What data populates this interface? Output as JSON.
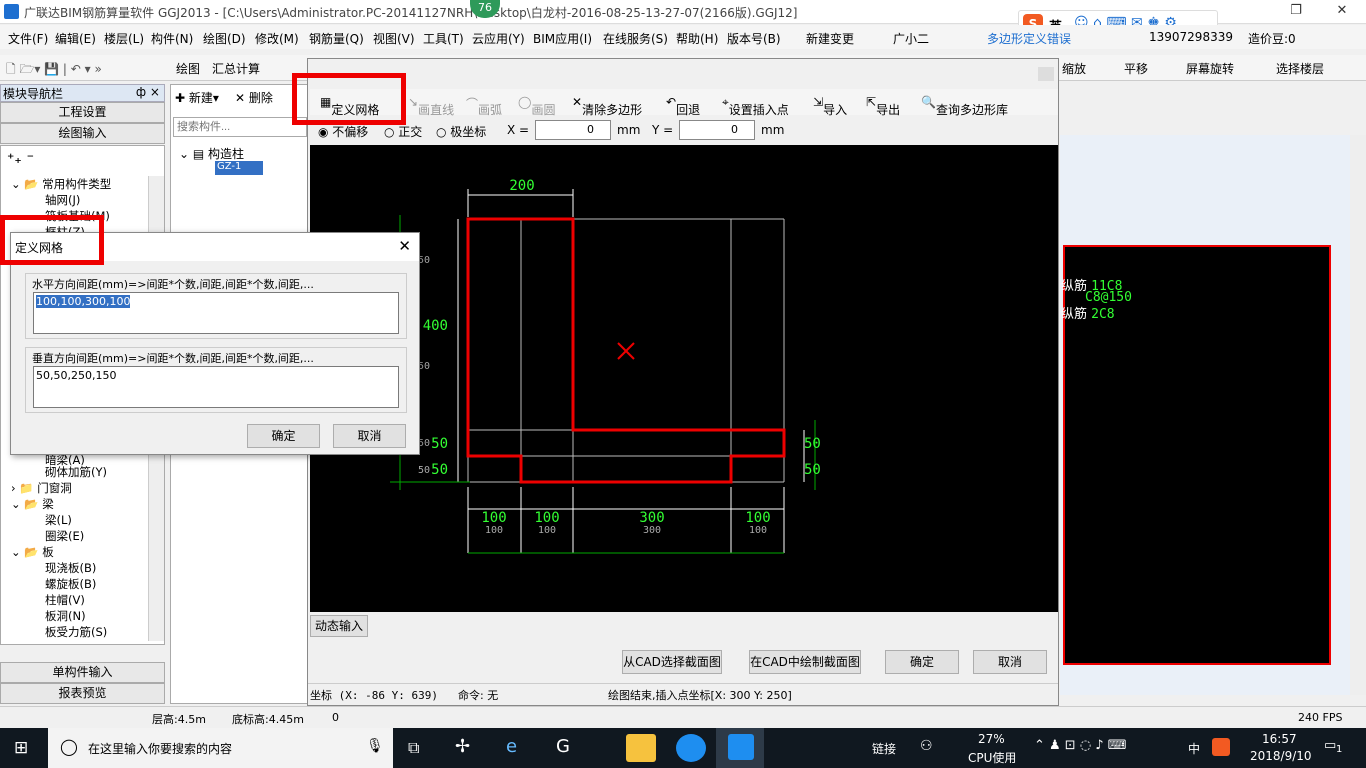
{
  "window": {
    "title": "广联达BIM钢筋算量软件 GGJ2013 - [C:\\Users\\Administrator.PC-20141127NRH\\Desktop\\白龙村-2016-08-25-13-27-07(2166版).GGJ12]",
    "badge": "76"
  },
  "menu": [
    "文件(F)",
    "编辑(E)",
    "楼层(L)",
    "构件(N)",
    "绘图(D)",
    "修改(M)",
    "钢筋量(Q)",
    "视图(V)",
    "工具(T)",
    "云应用(Y)",
    "BIM应用(I)",
    "在线服务(S)",
    "帮助(H)",
    "版本号(B)",
    "新建变更",
    "广小二"
  ],
  "menu_right": {
    "promo": "多边形定义错误",
    "phone": "13907298339",
    "beans": "造价豆:0"
  },
  "toolbar": {
    "draw": "绘图",
    "sum": "汇总计算",
    "zoom": "缩放",
    "pan": "平移",
    "rotate": "屏幕旋转",
    "floor": "选择楼层"
  },
  "ime": {
    "lang": "英"
  },
  "nav": {
    "header": "模块导航栏",
    "pin": "ф ×",
    "project": "工程设置",
    "draw_input": "绘图输入",
    "single": "单构件输入",
    "report": "报表预览"
  },
  "tree": [
    {
      "label": "常用构件类型"
    },
    {
      "label": "轴网(J)"
    },
    {
      "label": "筏板基础(M)"
    },
    {
      "label": "框柱(Z)"
    },
    {
      "label": "暗梁(A)"
    },
    {
      "label": "砌体加筋(Y)"
    },
    {
      "label": "门窗洞"
    },
    {
      "label": "梁"
    },
    {
      "label": "梁(L)"
    },
    {
      "label": "圈梁(E)"
    },
    {
      "label": "板"
    },
    {
      "label": "现浇板(B)"
    },
    {
      "label": "螺旋板(B)"
    },
    {
      "label": "柱帽(V)"
    },
    {
      "label": "板洞(N)"
    },
    {
      "label": "板受力筋(S)"
    }
  ],
  "panel2": {
    "new": "新建",
    "delete": "删除",
    "search_placeholder": "搜索构件...",
    "node": "构造柱",
    "item": "GZ-1"
  },
  "dialog": {
    "toolbar": [
      "定义网格",
      "画直线",
      "画弧",
      "画圆",
      "清除多边形",
      "回退",
      "设置插入点",
      "导入",
      "导出",
      "查询多边形库"
    ],
    "opts": {
      "none": "不偏移",
      "ortho": "正交",
      "polar": "极坐标",
      "x_label": "X =",
      "x_val": "0",
      "y_label": "Y =",
      "y_val": "0",
      "unit": "mm"
    },
    "dyn": "动态输入",
    "buttons": {
      "from_cad": "从CAD选择截面图",
      "in_cad": "在CAD中绘制截面图",
      "ok": "确定",
      "cancel": "取消"
    },
    "status": {
      "coord": "坐标 (X: -86 Y: 639)",
      "cmd": "命令: 无",
      "msg": "绘图结束,插入点坐标[X: 300 Y: 250]"
    }
  },
  "cad": {
    "dims_top": "200",
    "dims_left": [
      "400",
      "50",
      "50"
    ],
    "dims_left_small": [
      "50",
      "50",
      "50",
      "50"
    ],
    "dims_right": [
      "50",
      "50"
    ],
    "dims_bottom": [
      "100",
      "100",
      "300",
      "100"
    ],
    "dims_bottom_small": [
      "100",
      "100",
      "300",
      "100"
    ]
  },
  "rebar": {
    "l1a": "纵筋",
    "l1b": "11C8",
    "l2": "C8@150",
    "l3a": "纵筋",
    "l3b": "2C8"
  },
  "grid_dialog": {
    "title": "定义网格",
    "h_label": "水平方向间距(mm)=>间距*个数,间距,间距*个数,间距,...",
    "h_value": "100,100,300,100",
    "v_label": "垂直方向间距(mm)=>间距*个数,间距,间距*个数,间距,...",
    "v_value": "50,50,250,150",
    "ok": "确定",
    "cancel": "取消"
  },
  "bottom": {
    "floor_h": "层高:4.5m",
    "base_h": "底标高:4.45m",
    "zero": "0",
    "fps": "240 FPS"
  },
  "taskbar": {
    "search": "在这里输入你要搜索的内容",
    "link": "链接",
    "cpu_pct": "27%",
    "cpu": "CPU使用",
    "ime": "中",
    "time": "16:57",
    "date": "2018/9/10",
    "notif": "1"
  }
}
